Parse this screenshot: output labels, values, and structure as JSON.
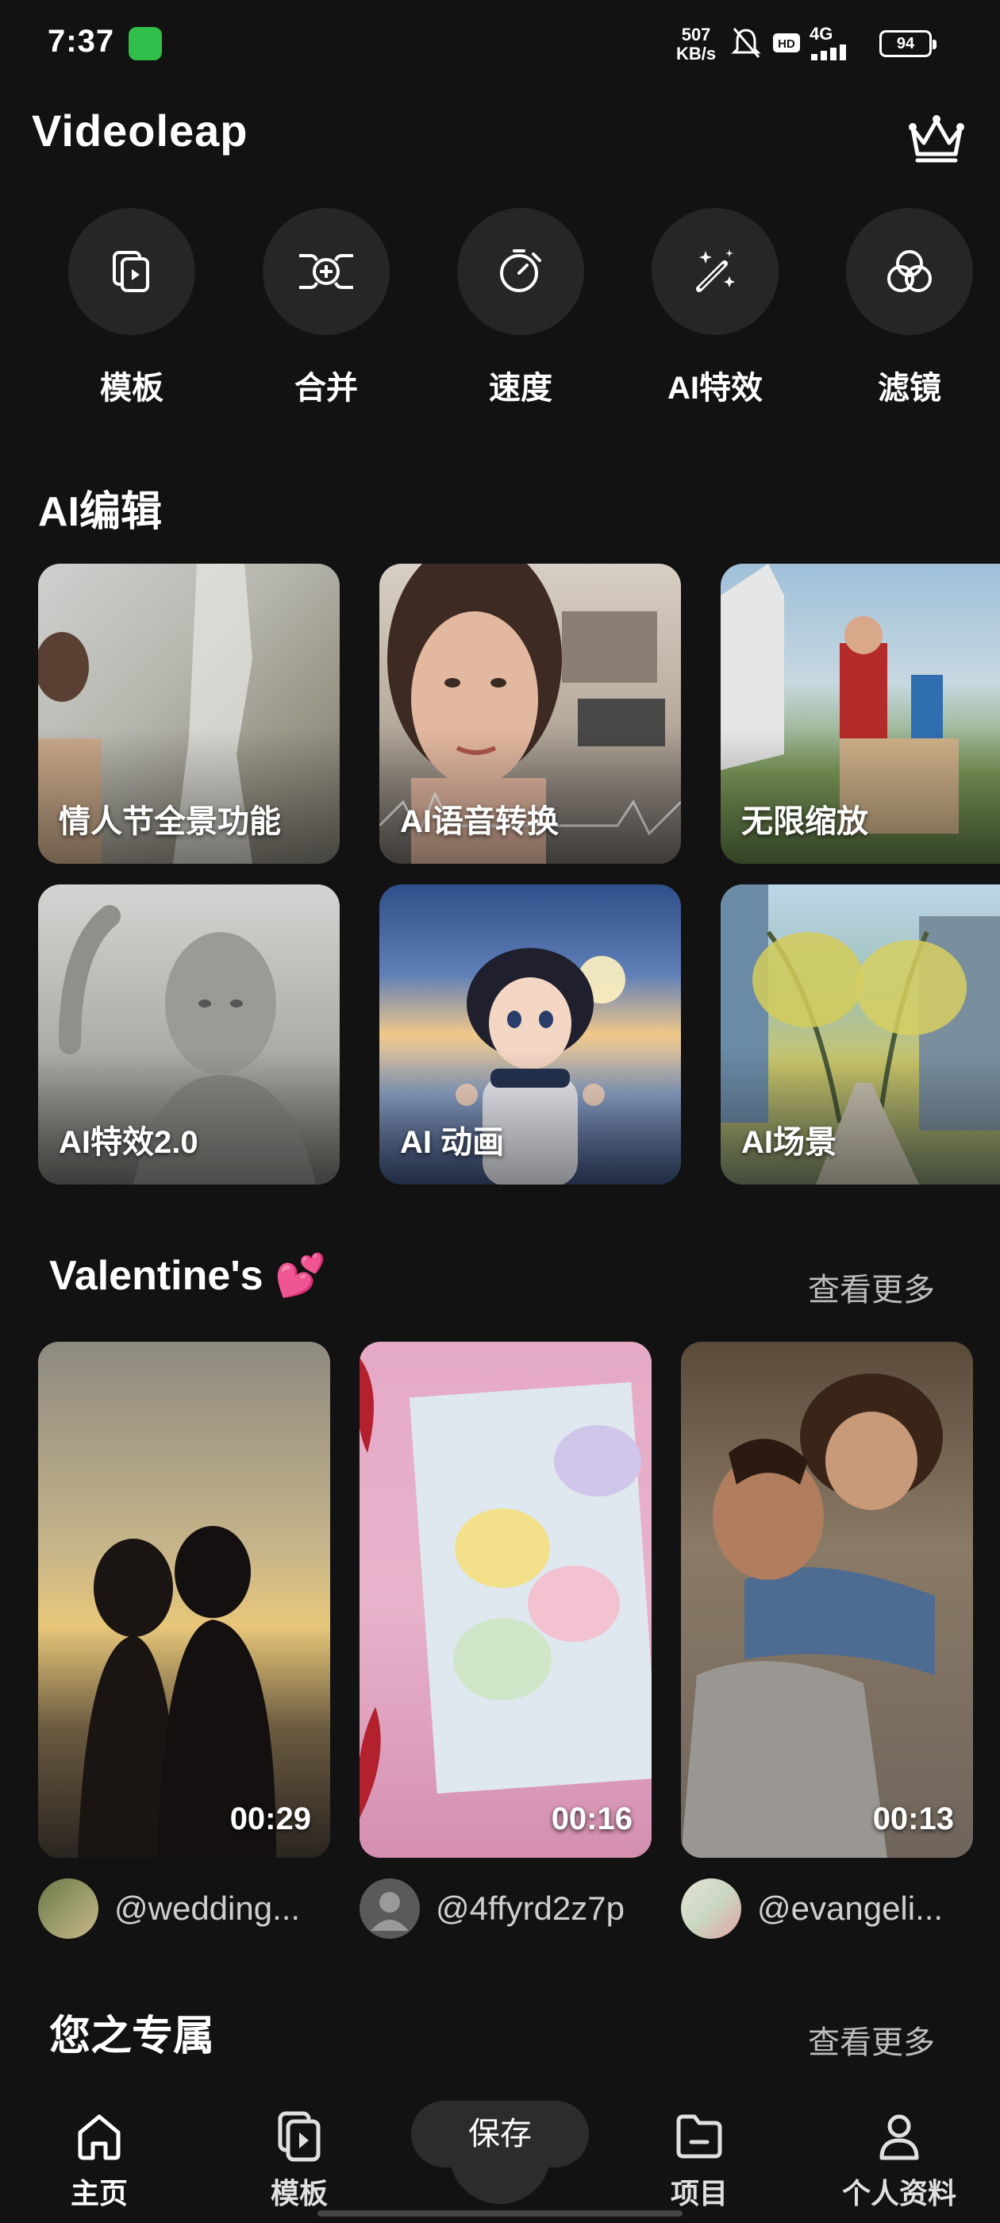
{
  "status_bar": {
    "time": "7:37",
    "speed_value": "507",
    "speed_unit": "KB/s",
    "network": "4G",
    "battery": "94"
  },
  "header": {
    "title": "Videoleap"
  },
  "tools": [
    {
      "label": "模板",
      "icon": "template-icon"
    },
    {
      "label": "合并",
      "icon": "merge-icon"
    },
    {
      "label": "速度",
      "icon": "speed-icon"
    },
    {
      "label": "AI特效",
      "icon": "magic-wand-icon"
    },
    {
      "label": "滤镜",
      "icon": "filter-icon"
    }
  ],
  "ai_section": {
    "title": "AI编辑",
    "tiles": [
      {
        "label": "情人节全景功能"
      },
      {
        "label": "AI语音转换"
      },
      {
        "label": "无限缩放"
      },
      {
        "label": "AI特效2.0"
      },
      {
        "label": "AI 动画"
      },
      {
        "label": "AI场景"
      }
    ]
  },
  "valentine_section": {
    "title": "Valentine's 💕",
    "see_more": "查看更多",
    "cards": [
      {
        "duration": "00:29",
        "author": "@wedding..."
      },
      {
        "duration": "00:16",
        "author": "@4ffyrd2z7p"
      },
      {
        "duration": "00:13",
        "author": "@evangeli..."
      }
    ]
  },
  "exclusive_section": {
    "title": "您之专属",
    "see_more": "查看更多"
  },
  "bottom_nav": {
    "home": "主页",
    "templates": "模板",
    "save": "保存",
    "projects": "项目",
    "profile": "个人资料"
  },
  "colors": {
    "background": "#121212",
    "tool_circle": "#262626",
    "muted_text": "#bdbdbd"
  }
}
